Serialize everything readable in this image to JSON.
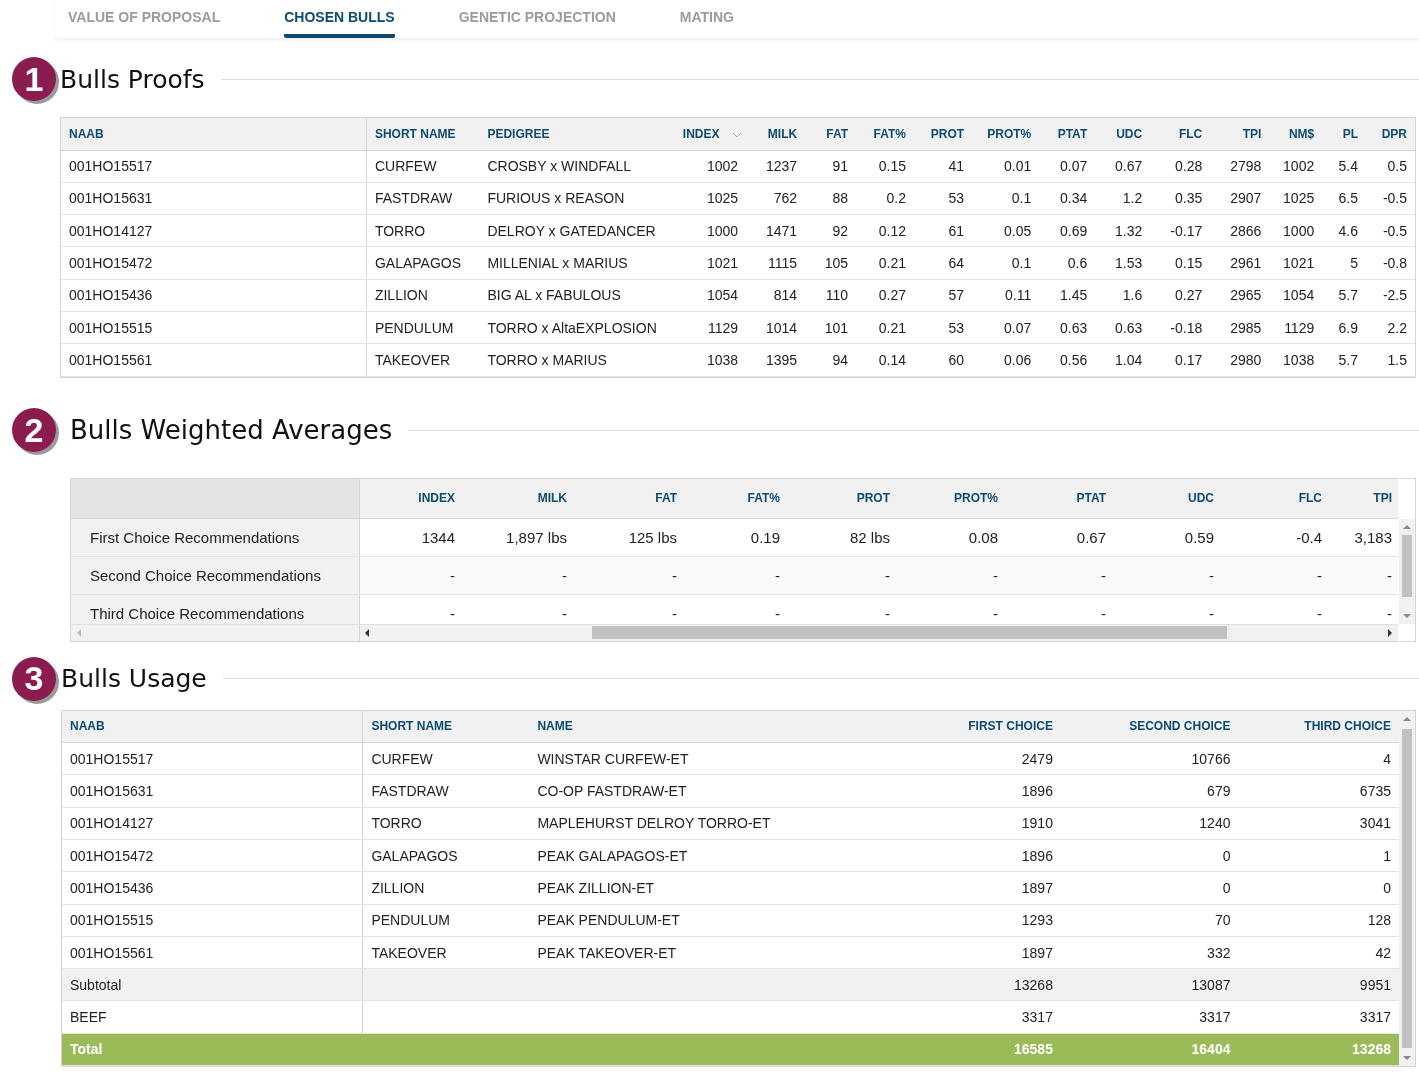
{
  "tabs": [
    {
      "label": "VALUE OF PROPOSAL",
      "selected": false
    },
    {
      "label": "CHOSEN BULLS",
      "selected": true
    },
    {
      "label": "GENETIC PROJECTION",
      "selected": false
    },
    {
      "label": "MATING",
      "selected": false
    }
  ],
  "proofs": {
    "number": "1",
    "title": "Bulls Proofs",
    "columns": [
      {
        "label": "NAAB",
        "sorted": false
      },
      {
        "label": "SHORT NAME",
        "sorted": false
      },
      {
        "label": "PEDIGREE",
        "sorted": false
      },
      {
        "label": "INDEX",
        "sorted": true
      },
      {
        "label": "MILK",
        "sorted": false
      },
      {
        "label": "FAT",
        "sorted": false
      },
      {
        "label": "FAT%",
        "sorted": false
      },
      {
        "label": "PROT",
        "sorted": false
      },
      {
        "label": "PROT%",
        "sorted": false
      },
      {
        "label": "PTAT",
        "sorted": false
      },
      {
        "label": "UDC",
        "sorted": false
      },
      {
        "label": "FLC",
        "sorted": false
      },
      {
        "label": "TPI",
        "sorted": false
      },
      {
        "label": "NM$",
        "sorted": false
      },
      {
        "label": "PL",
        "sorted": false
      },
      {
        "label": "DPR",
        "sorted": false
      }
    ],
    "rows": [
      [
        "001HO15517",
        "CURFEW",
        "CROSBY x WINDFALL",
        "1002",
        "1237",
        "91",
        "0.15",
        "41",
        "0.01",
        "0.07",
        "0.67",
        "0.28",
        "2798",
        "1002",
        "5.4",
        "0.5"
      ],
      [
        "001HO15631",
        "FASTDRAW",
        "FURIOUS x REASON",
        "1025",
        "762",
        "88",
        "0.2",
        "53",
        "0.1",
        "0.34",
        "1.2",
        "0.35",
        "2907",
        "1025",
        "6.5",
        "-0.5"
      ],
      [
        "001HO14127",
        "TORRO",
        "DELROY x GATEDANCER",
        "1000",
        "1471",
        "92",
        "0.12",
        "61",
        "0.05",
        "0.69",
        "1.32",
        "-0.17",
        "2866",
        "1000",
        "4.6",
        "-0.5"
      ],
      [
        "001HO15472",
        "GALAPAGOS",
        "MILLENIAL x MARIUS",
        "1021",
        "1115",
        "105",
        "0.21",
        "64",
        "0.1",
        "0.6",
        "1.53",
        "0.15",
        "2961",
        "1021",
        "5",
        "-0.8"
      ],
      [
        "001HO15436",
        "ZILLION",
        "BIG AL x FABULOUS",
        "1054",
        "814",
        "110",
        "0.27",
        "57",
        "0.11",
        "1.45",
        "1.6",
        "0.27",
        "2965",
        "1054",
        "5.7",
        "-2.5"
      ],
      [
        "001HO15515",
        "PENDULUM",
        "TORRO x AltaEXPLOSION",
        "1129",
        "1014",
        "101",
        "0.21",
        "53",
        "0.07",
        "0.63",
        "0.63",
        "-0.18",
        "2985",
        "1129",
        "6.9",
        "2.2"
      ],
      [
        "001HO15561",
        "TAKEOVER",
        "TORRO x MARIUS",
        "1038",
        "1395",
        "94",
        "0.14",
        "60",
        "0.06",
        "0.56",
        "1.04",
        "0.17",
        "2980",
        "1038",
        "5.7",
        "1.5"
      ]
    ]
  },
  "averages": {
    "number": "2",
    "title": "Bulls Weighted Averages",
    "columns": [
      "INDEX",
      "MILK",
      "FAT",
      "FAT%",
      "PROT",
      "PROT%",
      "PTAT",
      "UDC",
      "FLC",
      "TPI"
    ],
    "rows": [
      {
        "label": "First Choice Recommendations",
        "values": [
          "1344",
          "1,897 lbs",
          "125 lbs",
          "0.19",
          "82 lbs",
          "0.08",
          "0.67",
          "0.59",
          "-0.4",
          "3,183"
        ]
      },
      {
        "label": "Second Choice Recommendations",
        "values": [
          "-",
          "-",
          "-",
          "-",
          "-",
          "-",
          "-",
          "-",
          "-",
          "-"
        ]
      },
      {
        "label": "Third Choice Recommendations",
        "values": [
          "-",
          "-",
          "-",
          "-",
          "-",
          "-",
          "-",
          "-",
          "-",
          "-"
        ]
      }
    ]
  },
  "usage": {
    "number": "3",
    "title": "Bulls Usage",
    "columns": [
      "NAAB",
      "SHORT NAME",
      "NAME",
      "FIRST CHOICE",
      "SECOND CHOICE",
      "THIRD CHOICE"
    ],
    "rows": [
      {
        "kind": "bull",
        "cells": [
          "001HO15517",
          "CURFEW",
          "WINSTAR CURFEW-ET",
          "2479",
          "10766",
          "4"
        ]
      },
      {
        "kind": "bull",
        "cells": [
          "001HO15631",
          "FASTDRAW",
          "CO-OP FASTDRAW-ET",
          "1896",
          "679",
          "6735"
        ]
      },
      {
        "kind": "bull",
        "cells": [
          "001HO14127",
          "TORRO",
          "MAPLEHURST DELROY TORRO-ET",
          "1910",
          "1240",
          "3041"
        ]
      },
      {
        "kind": "bull",
        "cells": [
          "001HO15472",
          "GALAPAGOS",
          "PEAK GALAPAGOS-ET",
          "1896",
          "0",
          "1"
        ]
      },
      {
        "kind": "bull",
        "cells": [
          "001HO15436",
          "ZILLION",
          "PEAK ZILLION-ET",
          "1897",
          "0",
          "0"
        ]
      },
      {
        "kind": "bull",
        "cells": [
          "001HO15515",
          "PENDULUM",
          "PEAK PENDULUM-ET",
          "1293",
          "70",
          "128"
        ]
      },
      {
        "kind": "bull",
        "cells": [
          "001HO15561",
          "TAKEOVER",
          "PEAK TAKEOVER-ET",
          "1897",
          "332",
          "42"
        ]
      },
      {
        "kind": "subtotal",
        "cells": [
          "Subtotal",
          "",
          "",
          "13268",
          "13087",
          "9951"
        ]
      },
      {
        "kind": "extra",
        "cells": [
          "BEEF",
          "",
          "",
          "3317",
          "3317",
          "3317"
        ]
      },
      {
        "kind": "total",
        "cells": [
          "Total",
          "",
          "",
          "16585",
          "16404",
          "13268"
        ]
      }
    ]
  }
}
